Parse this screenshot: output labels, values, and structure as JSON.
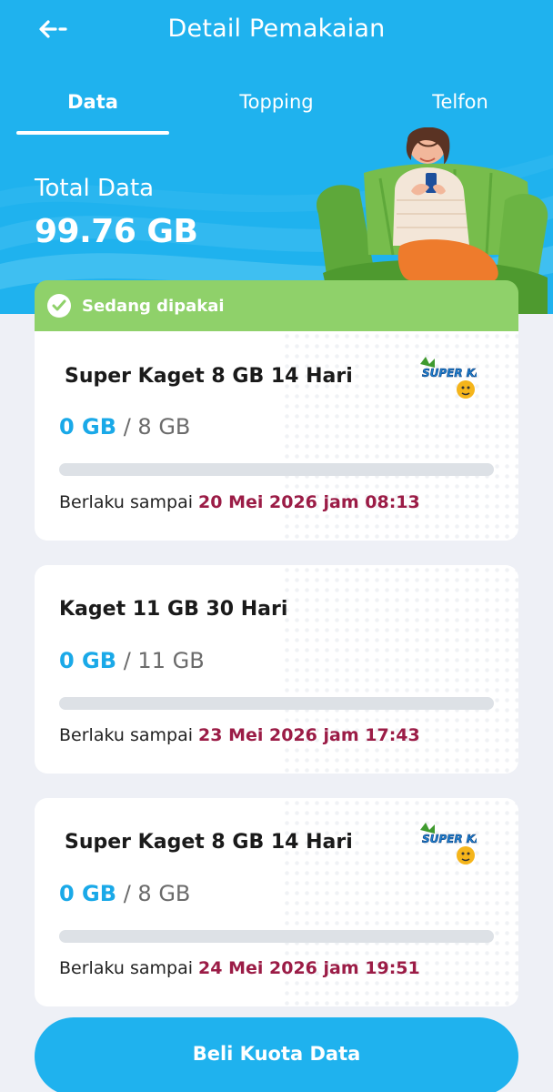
{
  "header": {
    "title": "Detail Pemakaian",
    "back_icon": "arrow-left-icon"
  },
  "tabs": [
    {
      "label": "Data",
      "active": true
    },
    {
      "label": "Topping",
      "active": false
    },
    {
      "label": "Telfon",
      "active": false
    }
  ],
  "summary": {
    "total_label": "Total Data",
    "total_value": "99.76 GB"
  },
  "status_banner": {
    "label": "Sedang dipakai",
    "icon": "check-circle-icon",
    "color": "#8fd16a"
  },
  "packages": [
    {
      "name": "Super Kaget 8 GB 14 Hari",
      "used": "0 GB",
      "quota": "8 GB",
      "separator": "/",
      "used_fraction": 0,
      "valid_prefix": "Berlaku sampai",
      "valid_until": "20 Mei 2026 jam 08:13",
      "logo": "super-kaget-logo",
      "logo_text": "SUPER KAGET"
    },
    {
      "name": "Kaget 11 GB 30 Hari",
      "used": "0 GB",
      "quota": "11 GB",
      "separator": "/",
      "used_fraction": 0,
      "valid_prefix": "Berlaku sampai",
      "valid_until": "23 Mei 2026 jam 17:43"
    },
    {
      "name": "Super Kaget 8 GB 14 Hari",
      "used": "0 GB",
      "quota": "8 GB",
      "separator": "/",
      "used_fraction": 0,
      "valid_prefix": "Berlaku sampai",
      "valid_until": "24 Mei 2026 jam 19:51",
      "logo": "super-kaget-logo",
      "logo_text": "SUPER KAGET"
    }
  ],
  "buy_button": {
    "label": "Beli Kuota Data"
  },
  "colors": {
    "brand": "#1fb2ee",
    "used_value": "#1aa9e8",
    "date": "#9b1c46",
    "banner": "#8fd16a"
  }
}
